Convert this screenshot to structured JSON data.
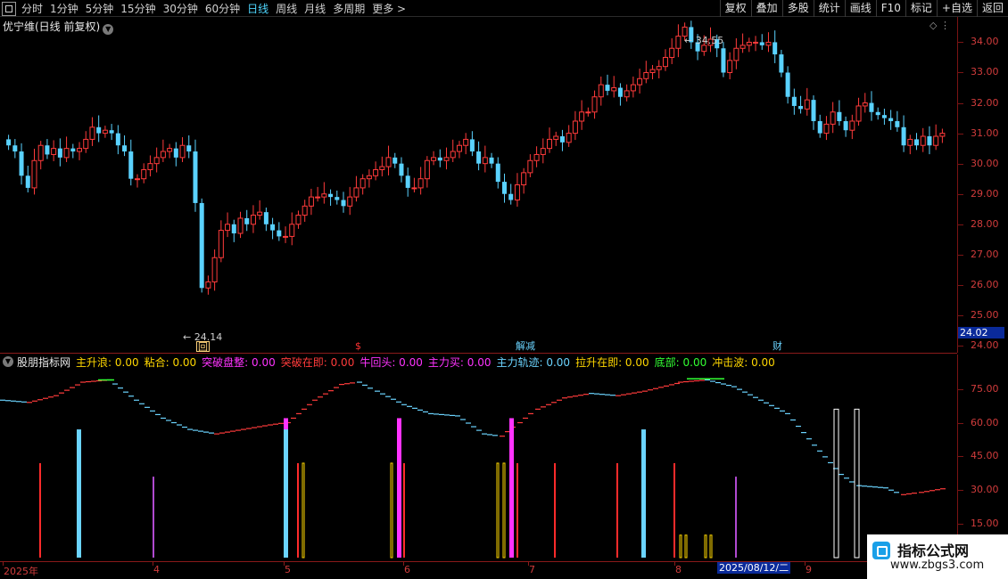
{
  "toolbar": {
    "tabs": [
      {
        "label": "分时",
        "active": false
      },
      {
        "label": "1分钟",
        "active": false
      },
      {
        "label": "5分钟",
        "active": false
      },
      {
        "label": "15分钟",
        "active": false
      },
      {
        "label": "30分钟",
        "active": false
      },
      {
        "label": "60分钟",
        "active": false
      },
      {
        "label": "日线",
        "active": true
      },
      {
        "label": "周线",
        "active": false
      },
      {
        "label": "月线",
        "active": false
      },
      {
        "label": "多周期",
        "active": false
      },
      {
        "label": "更多 >",
        "active": false
      }
    ],
    "right_buttons": [
      "复权",
      "叠加",
      "多股",
      "统计",
      "画线",
      "F10",
      "标记",
      "+自选",
      "返回"
    ]
  },
  "stock": {
    "title": "优宁维(日线 前复权)",
    "high_note": "34.55",
    "low_note": "24.14",
    "current_price": "24.02"
  },
  "price_axis": {
    "ticks": [
      "34.00",
      "33.00",
      "32.00",
      "31.00",
      "30.00",
      "29.00",
      "28.00",
      "27.00",
      "26.00",
      "25.00",
      "24.00"
    ]
  },
  "markers": {
    "hui": "回",
    "dollar": "$",
    "jiejian": "解减",
    "cai": "财"
  },
  "indicator": {
    "name": "股朋指标网",
    "legend": [
      {
        "label": "主升浪: 0.00",
        "color": "#ffd700"
      },
      {
        "label": "粘合: 0.00",
        "color": "#ffd700"
      },
      {
        "label": "突破盘整: 0.00",
        "color": "#ff33ff"
      },
      {
        "label": "突破在即: 0.00",
        "color": "#ff3b3b"
      },
      {
        "label": "牛回头: 0.00",
        "color": "#ff33ff"
      },
      {
        "label": "主力买: 0.00",
        "color": "#ff33ff"
      },
      {
        "label": "主力轨迹: 0.00",
        "color": "#6bd4ff"
      },
      {
        "label": "拉升在即: 0.00",
        "color": "#ffd700"
      },
      {
        "label": "底部: 0.00",
        "color": "#33ff33"
      },
      {
        "label": "冲击波: 0.00",
        "color": "#ffd700"
      }
    ],
    "axis_ticks": [
      "75.00",
      "60.00",
      "45.00",
      "30.00",
      "15.00"
    ]
  },
  "date_axis": {
    "labels": [
      "2025年",
      "4",
      "5",
      "6",
      "7",
      "8",
      "9"
    ],
    "cursor_date": "2025/08/12/二"
  },
  "watermark": {
    "title": "指标公式网",
    "url": "www.zbgs3.com"
  },
  "colors": {
    "up": "#ff3b3b",
    "down": "#5ad2ff",
    "cyan": "#6bd4ff",
    "magenta": "#ff33ff",
    "yellow": "#ffd700",
    "green": "#33ff33"
  },
  "chart_data": {
    "type": "candlestick",
    "title": "优宁维(日线 前复权)",
    "y_range": [
      24,
      34.6
    ],
    "price_high": 34.55,
    "price_low": 24.14,
    "close_series": [
      30.6,
      30.4,
      29.6,
      29.2,
      30.1,
      30.6,
      30.3,
      30.5,
      30.2,
      30.5,
      30.4,
      30.5,
      30.8,
      31.2,
      31.0,
      31.1,
      31.0,
      30.6,
      30.4,
      29.5,
      29.5,
      29.8,
      30.0,
      30.2,
      30.4,
      30.5,
      30.2,
      30.6,
      30.4,
      28.7,
      25.9,
      26.1,
      26.9,
      27.8,
      28.0,
      27.7,
      28.2,
      28.0,
      28.3,
      28.4,
      28.0,
      27.8,
      27.6,
      27.6,
      28.0,
      28.3,
      28.6,
      28.9,
      28.9,
      29.0,
      28.9,
      28.8,
      28.6,
      28.9,
      29.2,
      29.5,
      29.6,
      29.8,
      29.9,
      30.2,
      30.0,
      29.6,
      29.2,
      29.2,
      29.5,
      30.1,
      30.2,
      30.1,
      30.2,
      30.4,
      30.6,
      30.8,
      30.4,
      30.0,
      30.2,
      30.0,
      29.4,
      29.0,
      28.8,
      29.3,
      29.7,
      30.1,
      30.3,
      30.5,
      30.8,
      30.9,
      30.7,
      31.0,
      31.4,
      31.7,
      31.7,
      32.2,
      32.6,
      32.4,
      32.5,
      32.2,
      32.4,
      32.6,
      32.8,
      33.0,
      33.1,
      33.2,
      33.5,
      33.8,
      34.2,
      34.5,
      34.0,
      33.7,
      33.9,
      34.1,
      33.8,
      33.0,
      33.4,
      33.8,
      33.9,
      34.0,
      34.0,
      33.9,
      34.0,
      33.6,
      33.0,
      32.2,
      31.9,
      31.8,
      32.1,
      31.4,
      31.0,
      31.3,
      31.7,
      31.4,
      31.1,
      31.4,
      31.9,
      32.0,
      31.7,
      31.6,
      31.5,
      31.4,
      31.2,
      30.6,
      30.8,
      30.6,
      30.9,
      30.6,
      30.9,
      31.0
    ]
  }
}
